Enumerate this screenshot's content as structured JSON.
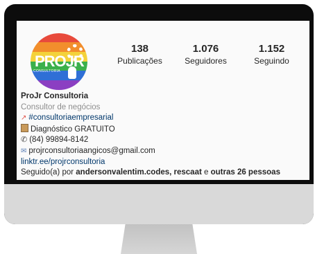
{
  "profile": {
    "logo_text": "PROJR",
    "logo_sub": "CONSULTORIA",
    "stats": [
      {
        "value": "138",
        "label": "Publicações"
      },
      {
        "value": "1.076",
        "label": "Seguidores"
      },
      {
        "value": "1.152",
        "label": "Seguindo"
      }
    ],
    "name": "ProJr Consultoria",
    "category": "Consultor de negócios",
    "hashtag": "#consultoriaempresarial",
    "line_diag": "Diagnóstico GRATUITO",
    "phone": "(84) 99894-8142",
    "email": "projrconsultoriaangicos@gmail.com",
    "link": "linktr.ee/projrconsultoria",
    "followed_prefix": "Seguido(a) por ",
    "followed_names": "andersonvalentim.codes, rescaat",
    "followed_mid": " e ",
    "followed_others": "outras 26 pessoas"
  },
  "icons": {
    "hashtag": "chart-increasing-icon",
    "diag": "clipboard-icon",
    "phone": "phone-icon",
    "email": "envelope-icon"
  }
}
